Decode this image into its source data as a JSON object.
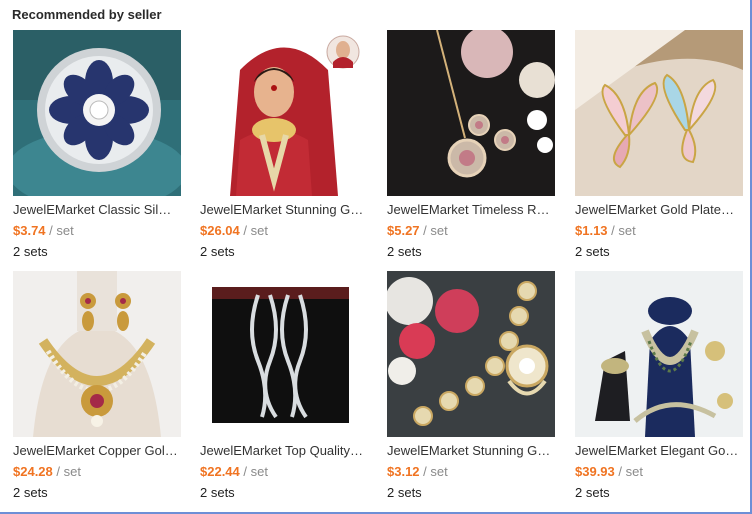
{
  "section": {
    "title": "Recommended by seller"
  },
  "colors": {
    "price": "#f07422",
    "border": "#6d8fd6"
  },
  "products": [
    {
      "name": "JewelEMarket Classic Sil…",
      "price": "$3.74",
      "unit": "/ set",
      "qty": "2 sets",
      "image": "blue-flower-ring-image"
    },
    {
      "name": "JewelEMarket Stunning G…",
      "price": "$26.04",
      "unit": "/ set",
      "qty": "2 sets",
      "image": "bridal-model-image"
    },
    {
      "name": "JewelEMarket Timeless R…",
      "price": "$5.27",
      "unit": "/ set",
      "qty": "2 sets",
      "image": "pendant-earring-set-image"
    },
    {
      "name": "JewelEMarket Gold Plate…",
      "price": "$1.13",
      "unit": "/ set",
      "qty": "2 sets",
      "image": "butterfly-earrings-image"
    },
    {
      "name": "JewelEMarket Copper Gol…",
      "price": "$24.28",
      "unit": "/ set",
      "qty": "2 sets",
      "image": "temple-necklace-image"
    },
    {
      "name": "JewelEMarket Top Quality…",
      "price": "$22.44",
      "unit": "/ set",
      "qty": "2 sets",
      "image": "long-cz-earrings-image"
    },
    {
      "name": "JewelEMarket Stunning G…",
      "price": "$3.12",
      "unit": "/ set",
      "qty": "2 sets",
      "image": "kundan-matha-patti-image"
    },
    {
      "name": "JewelEMarket Elegant Go…",
      "price": "$39.93",
      "unit": "/ set",
      "qty": "2 sets",
      "image": "bridal-set-display-image"
    }
  ]
}
